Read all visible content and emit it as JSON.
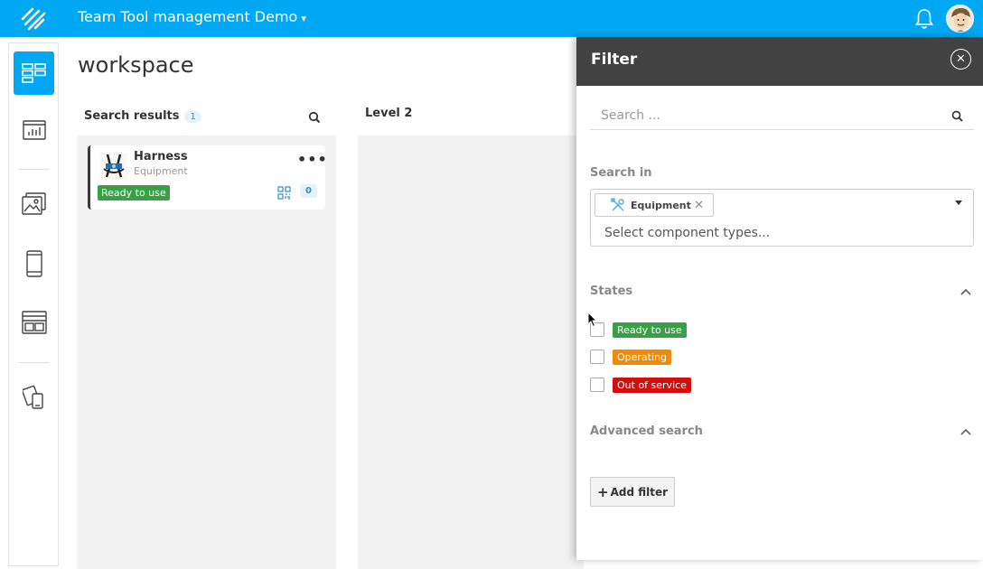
{
  "header": {
    "title": "Team Tool management Demo",
    "chevron": "▾",
    "icons": [
      "logo-icon",
      "bell-icon",
      "user-avatar"
    ]
  },
  "sidebar": {
    "items": [
      "workspace-icon",
      "dashboard-icon",
      "gallery-icon",
      "mobile-icon",
      "layout-icon",
      "devices-icon"
    ],
    "active": "workspace-icon"
  },
  "main": {
    "page_title": "workspace",
    "columns": [
      {
        "title": "Search results",
        "count": "1"
      },
      {
        "title": "Level 2"
      }
    ],
    "card": {
      "title": "Harness",
      "subtitle": "Equipment",
      "menu": "•••",
      "status": "Ready to use",
      "count": "0"
    }
  },
  "filter": {
    "title": "Filter",
    "close": "✕",
    "search_placeholder": "Search ...",
    "search_in_label": "Search in",
    "chip_label": "Equipment",
    "chip_remove": "✕",
    "select_placeholder": "Select component types...",
    "states_label": "States",
    "states": [
      {
        "label": "Ready to use",
        "color": "#3aa047"
      },
      {
        "label": "Operating",
        "color": "#f08a0a"
      },
      {
        "label": "Out of service",
        "color": "#d40d0d"
      }
    ],
    "advanced_label": "Advanced search",
    "add_filter_icon": "+",
    "add_filter_label": "Add filter"
  },
  "colors": {
    "brand": "#00a8f3",
    "panel_header": "#424242"
  }
}
